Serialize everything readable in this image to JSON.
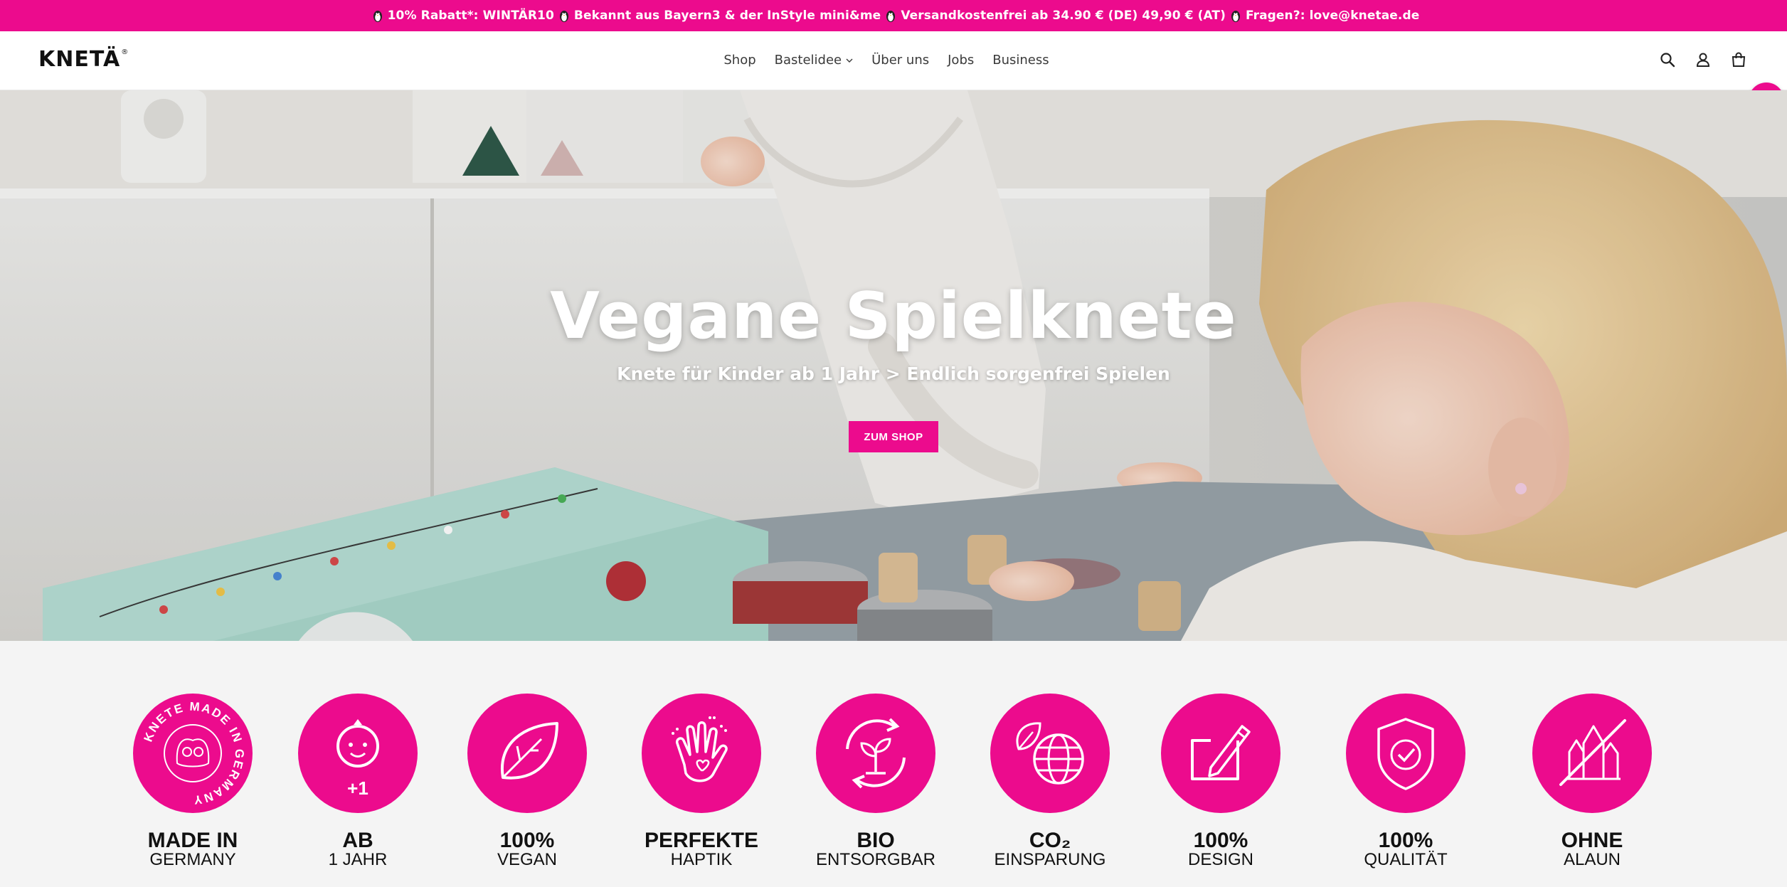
{
  "announcement": {
    "segments": [
      "10% Rabatt*: WINTÄR10",
      "Bekannt aus Bayern3 & der InStyle mini&me",
      "Versandkostenfrei ab 34.90 € (DE) 49,90 € (AT)",
      "Fragen?: love@knetae.de"
    ]
  },
  "header": {
    "logo": "KNETÄ",
    "logo_mark": "®",
    "nav": [
      "Shop",
      "Bastelidee",
      "Über uns",
      "Jobs",
      "Business"
    ],
    "icons": [
      "search-icon",
      "account-icon",
      "cart-icon"
    ]
  },
  "floating_cart": {
    "icon": "cart-icon"
  },
  "hero": {
    "title": "Vegane Spielknete",
    "subtitle": "Knete für Kinder ab 1 Jahr > Endlich sorgenfrei Spielen",
    "button": "ZUM SHOP"
  },
  "features": [
    {
      "l1": "MADE IN",
      "l2": "GERMANY",
      "icon": "made-in-germany-icon"
    },
    {
      "l1": "AB",
      "l2": "1 JAHR",
      "icon": "baby-icon",
      "badge": "+1"
    },
    {
      "l1": "100%",
      "l2": "VEGAN",
      "icon": "leaf-icon"
    },
    {
      "l1": "PERFEKTE",
      "l2": "HAPTIK",
      "icon": "hand-icon"
    },
    {
      "l1": "BIO",
      "l2": "ENTSORGBAR",
      "icon": "recycle-plant-icon"
    },
    {
      "l1": "CO₂",
      "l2": "EINSPARUNG",
      "icon": "globe-leaf-icon"
    },
    {
      "l1": "100%",
      "l2": "DESIGN",
      "icon": "design-pen-icon"
    },
    {
      "l1": "100%",
      "l2": "QUALITÄT",
      "icon": "shield-check-icon"
    },
    {
      "l1": "OHNE",
      "l2": "ALAUN",
      "icon": "crystal-crossed-icon"
    }
  ],
  "badge_text": "KNETE MADE IN GERMANY",
  "colors": {
    "accent": "#ec0b8d",
    "text": "#111111",
    "background": "#f4f4f4"
  }
}
